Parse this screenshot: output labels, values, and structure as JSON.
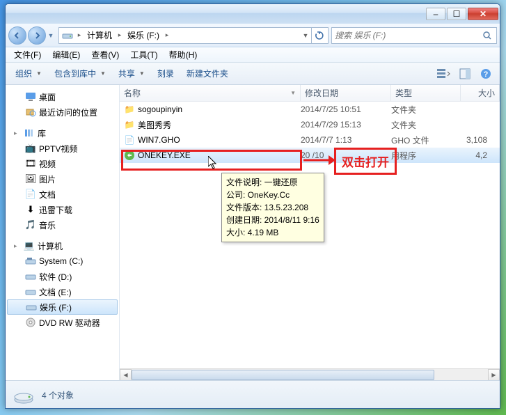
{
  "title_buttons": {
    "min": "–",
    "max": "☐",
    "close": "✕"
  },
  "breadcrumb": {
    "item1": "计算机",
    "item2": "娱乐 (F:)"
  },
  "search": {
    "placeholder": "搜索 娱乐 (F:)"
  },
  "menu": {
    "file": "文件(F)",
    "edit": "编辑(E)",
    "view": "查看(V)",
    "tools": "工具(T)",
    "help": "帮助(H)"
  },
  "toolbar": {
    "organize": "组织",
    "include": "包含到库中",
    "share": "共享",
    "burn": "刻录",
    "newfolder": "新建文件夹"
  },
  "sidebar": {
    "desktop": "桌面",
    "recent": "最近访问的位置",
    "lib": "库",
    "pptv": "PPTV视频",
    "video": "视频",
    "pictures": "图片",
    "docs": "文档",
    "xunlei": "迅雷下载",
    "music": "音乐",
    "computer": "计算机",
    "drive_c": "System (C:)",
    "drive_d": "软件 (D:)",
    "drive_e": "文档 (E:)",
    "drive_f": "娱乐 (F:)",
    "dvd": "DVD RW 驱动器"
  },
  "columns": {
    "name": "名称",
    "date": "修改日期",
    "type": "类型",
    "size": "大小"
  },
  "files": [
    {
      "name": "sogoupinyin",
      "date": "2014/7/25 10:51",
      "type": "文件夹",
      "size": "",
      "icon": "folder"
    },
    {
      "name": "美图秀秀",
      "date": "2014/7/29 15:13",
      "type": "文件夹",
      "size": "",
      "icon": "folder"
    },
    {
      "name": "WIN7.GHO",
      "date": "2014/7/7 1:13",
      "type": "GHO 文件",
      "size": "3,108",
      "icon": "file"
    },
    {
      "name": "ONEKEY.EXE",
      "date": "20    /10",
      "type": "用程序",
      "size": "4,2",
      "icon": "exe"
    }
  ],
  "tooltip": {
    "l1": "文件说明: 一键还原",
    "l2": "公司: OneKey.Cc",
    "l3": "文件版本: 13.5.23.208",
    "l4": "创建日期: 2014/8/11 9:16",
    "l5": "大小: 4.19 MB"
  },
  "annotation": {
    "label": "双击打开"
  },
  "status": {
    "text": "4 个对象"
  }
}
